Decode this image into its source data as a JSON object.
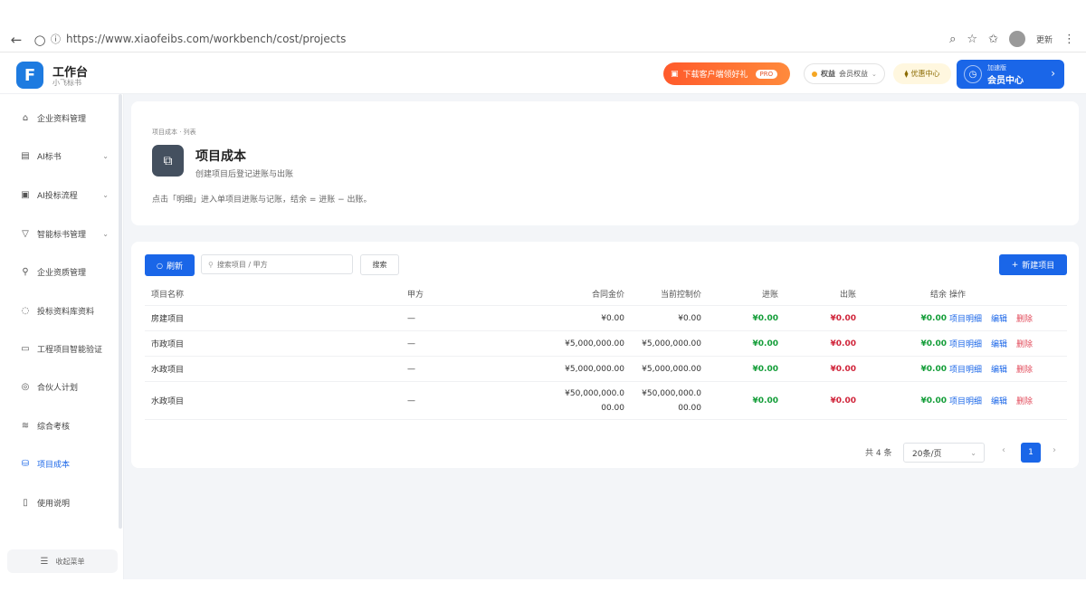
{
  "browser": {
    "back": "←",
    "reload": "○",
    "url": "https://www.xiaofeibs.com/workbench/cost/projects",
    "profile_label": "更新"
  },
  "app": {
    "title": "工作台",
    "subtitle": "小飞标书"
  },
  "header": {
    "promo_label": "下载客户端领好礼",
    "promo_badge": "PRO",
    "member_pill_label": "权益",
    "member_pill_sub": "会员权益",
    "coupon_label": "优惠中心",
    "member_center_top": "加速版",
    "member_center_label": "会员中心"
  },
  "sidebar": {
    "items": [
      {
        "label": "企业资料管理",
        "icon": "building-icon"
      },
      {
        "label": "AI标书",
        "icon": "document-icon"
      },
      {
        "label": "AI投标流程",
        "icon": "workflow-icon"
      },
      {
        "label": "智能标书管理",
        "icon": "filter-icon"
      },
      {
        "label": "企业资质管理",
        "icon": "search-icon"
      },
      {
        "label": "投标资料库资料",
        "icon": "chat-icon"
      },
      {
        "label": "工程项目智能验证",
        "icon": "monitor-icon"
      },
      {
        "label": "合伙人计划",
        "icon": "handshake-icon"
      },
      {
        "label": "综合考核",
        "icon": "layers-icon"
      },
      {
        "label": "项目成本",
        "icon": "database-icon"
      },
      {
        "label": "使用说明",
        "icon": "file-icon"
      }
    ],
    "collapse_label": "收起菜单"
  },
  "page": {
    "breadcrumb": "项目成本 · 列表",
    "title": "项目成本",
    "subtitle": "创建项目后登记进账与出账",
    "hint": "点击「明细」进入单项目进账与记账，结余 = 进账 − 出账。"
  },
  "toolbar": {
    "refresh_label": "刷新",
    "search_placeholder": "搜索项目 / 甲方",
    "search_button": "搜索",
    "new_label": "新建项目"
  },
  "table": {
    "headers": [
      "项目名称",
      "甲方",
      "合同金价",
      "当前控制价",
      "进账",
      "出账",
      "结余",
      "操作"
    ],
    "rows": [
      {
        "name": "房建项目",
        "party": "—",
        "contract": "¥0.00",
        "control": "¥0.00",
        "income": "¥0.00",
        "expense": "¥0.00",
        "balance": "¥0.00",
        "op_detail": "项目明细",
        "op_edit": "编辑",
        "op_delete": "删除"
      },
      {
        "name": "市政项目",
        "party": "—",
        "contract": "¥5,000,000.00",
        "control": "¥5,000,000.00",
        "income": "¥0.00",
        "expense": "¥0.00",
        "balance": "¥0.00",
        "op_detail": "项目明细",
        "op_edit": "编辑",
        "op_delete": "删除"
      },
      {
        "name": "水政项目",
        "party": "—",
        "contract": "¥5,000,000.00",
        "control": "¥5,000,000.00",
        "income": "¥0.00",
        "expense": "¥0.00",
        "balance": "¥0.00",
        "op_detail": "项目明细",
        "op_edit": "编辑",
        "op_delete": "删除"
      },
      {
        "name": "水政项目",
        "party": "—",
        "contract_line1": "¥50,000,000.0",
        "contract_line2": "00.00",
        "control_line1": "¥50,000,000.0",
        "control_line2": "00.00",
        "income": "¥0.00",
        "expense": "¥0.00",
        "balance": "¥0.00",
        "op_detail": "项目明细",
        "op_edit": "编辑",
        "op_delete": "删除"
      }
    ]
  },
  "pagination": {
    "total": "共 4 条",
    "page_size": "20条/页",
    "current_page": "1"
  },
  "colors": {
    "primary": "#1a66e8",
    "income": "#139d38",
    "expense": "#d0243a"
  }
}
